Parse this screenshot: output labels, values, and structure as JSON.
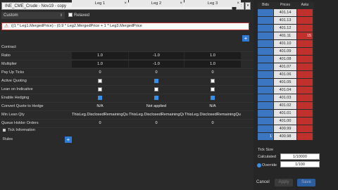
{
  "title": "INE_CME_Crude - Nov19 - copy",
  "close_icon": "×",
  "dropdown_icon": "▾",
  "mode_select": {
    "value": "Custom",
    "arrow": "⇕"
  },
  "relaxed_label": "Relaxed",
  "formula": "((1 * Leg1.MergedPrice) - (0.9 * Leg2.MergedPrice + 1 * Leg3.MergedPrice",
  "warning_icon": "⚠",
  "legs": [
    {
      "label": "Leg 1",
      "close": "×"
    },
    {
      "label": "Leg 2",
      "close": "×"
    },
    {
      "label": "Leg 3",
      "close": "×"
    }
  ],
  "add_leg": "+",
  "rows": [
    {
      "label": "Contract",
      "values": [
        "",
        "",
        ""
      ]
    },
    {
      "label": "Ratio",
      "values": [
        "1.0",
        "-1.0",
        "1.0"
      ]
    },
    {
      "label": "Multiplier",
      "values": [
        "1.0",
        "-1.0",
        "1.0"
      ]
    },
    {
      "label": "Pay Up Ticks",
      "values": [
        "0",
        "0",
        "0"
      ]
    },
    {
      "label": "Active Quoting",
      "checks": [
        false,
        true,
        false
      ]
    },
    {
      "label": "Lean on Indicative",
      "checks": [
        false,
        false,
        false
      ]
    },
    {
      "label": "Enable Hedging",
      "checks": [
        true,
        true,
        true
      ]
    },
    {
      "label": "Convert Quote to Hedge",
      "values": [
        "N/A",
        "Not applied",
        "N/A"
      ]
    },
    {
      "label": "Min Lean Qty",
      "values": [
        "ThisLeg.DisclosedRemainingQua",
        "ThisLeg.DisclosedRemainingQua",
        "ThisLeg.DisclosedRemainingQua"
      ]
    },
    {
      "label": "Queue Holder Orders",
      "values": [
        "0",
        "0",
        "0"
      ]
    }
  ],
  "tick_info_label": "Tick Information",
  "rules_label": "Rules",
  "rules_add": "+",
  "ladder": {
    "headers": [
      "Bids",
      "Prices",
      "Asks"
    ],
    "prices": [
      "401.14",
      "401.13",
      "401.12",
      "401.11",
      "401.10",
      "401.09",
      "401.08",
      "401.07",
      "401.06",
      "401.05",
      "401.04",
      "401.03",
      "401.02",
      "401.01",
      "401.00",
      "400.99",
      "400.98"
    ],
    "ask_qty": "15",
    "ask_qty_index": 3,
    "bid_qty": "1",
    "bid_qty_index": 16
  },
  "tick_size_label": "Tick Size",
  "calculated_label": "Calculated",
  "calculated_value": "1/10000",
  "override_label": "Override",
  "override_value": "1/100",
  "buttons": {
    "cancel": "Cancel",
    "apply": "Apply",
    "save": "Save"
  },
  "colors": {
    "bid": "#3a76c2",
    "ask": "#c0302c",
    "accent": "#2f7ad6"
  }
}
